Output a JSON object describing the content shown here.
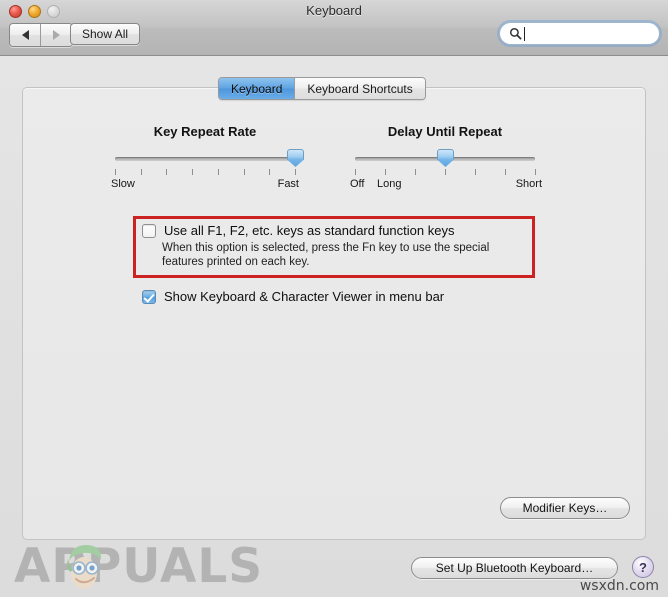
{
  "window": {
    "title": "Keyboard",
    "traffic_lights": [
      "close",
      "minimize",
      "zoom"
    ]
  },
  "toolbar": {
    "back_icon": "triangle-left-icon",
    "forward_icon": "triangle-right-icon",
    "show_all_label": "Show All",
    "search": {
      "value": "",
      "placeholder": "",
      "icon": "search-icon"
    }
  },
  "tabs": [
    {
      "label": "Keyboard",
      "active": true
    },
    {
      "label": "Keyboard Shortcuts",
      "active": false
    }
  ],
  "sliders": [
    {
      "title": "Key Repeat Rate",
      "left_label": "Slow",
      "right_label": "Fast",
      "extra_label": "",
      "ticks": 8,
      "value_index": 7,
      "thumb_percent": 100
    },
    {
      "title": "Delay Until Repeat",
      "left_label": "Off",
      "extra_label": "Long",
      "right_label": "Short",
      "ticks": 7,
      "value_index": 3,
      "thumb_percent": 50
    }
  ],
  "options": {
    "function_keys": {
      "label": "Use all F1, F2, etc. keys as standard function keys",
      "checked": false,
      "description": "When this option is selected, press the Fn key to use the special features printed on each key.",
      "highlighted": true,
      "highlight_color": "#cc2222"
    },
    "show_viewer": {
      "label": "Show Keyboard & Character Viewer in menu bar",
      "checked": true
    }
  },
  "buttons": {
    "modifier_keys": "Modifier Keys…",
    "bluetooth_keyboard": "Set Up Bluetooth Keyboard…",
    "help": "?"
  },
  "watermarks": {
    "appuals": "APPUALS",
    "wsxdn": "wsxdn.com"
  },
  "colors": {
    "accent_blue": "#5ea3e2",
    "annotation_red": "#cc2222",
    "help_purple": "#c9c0e0"
  }
}
